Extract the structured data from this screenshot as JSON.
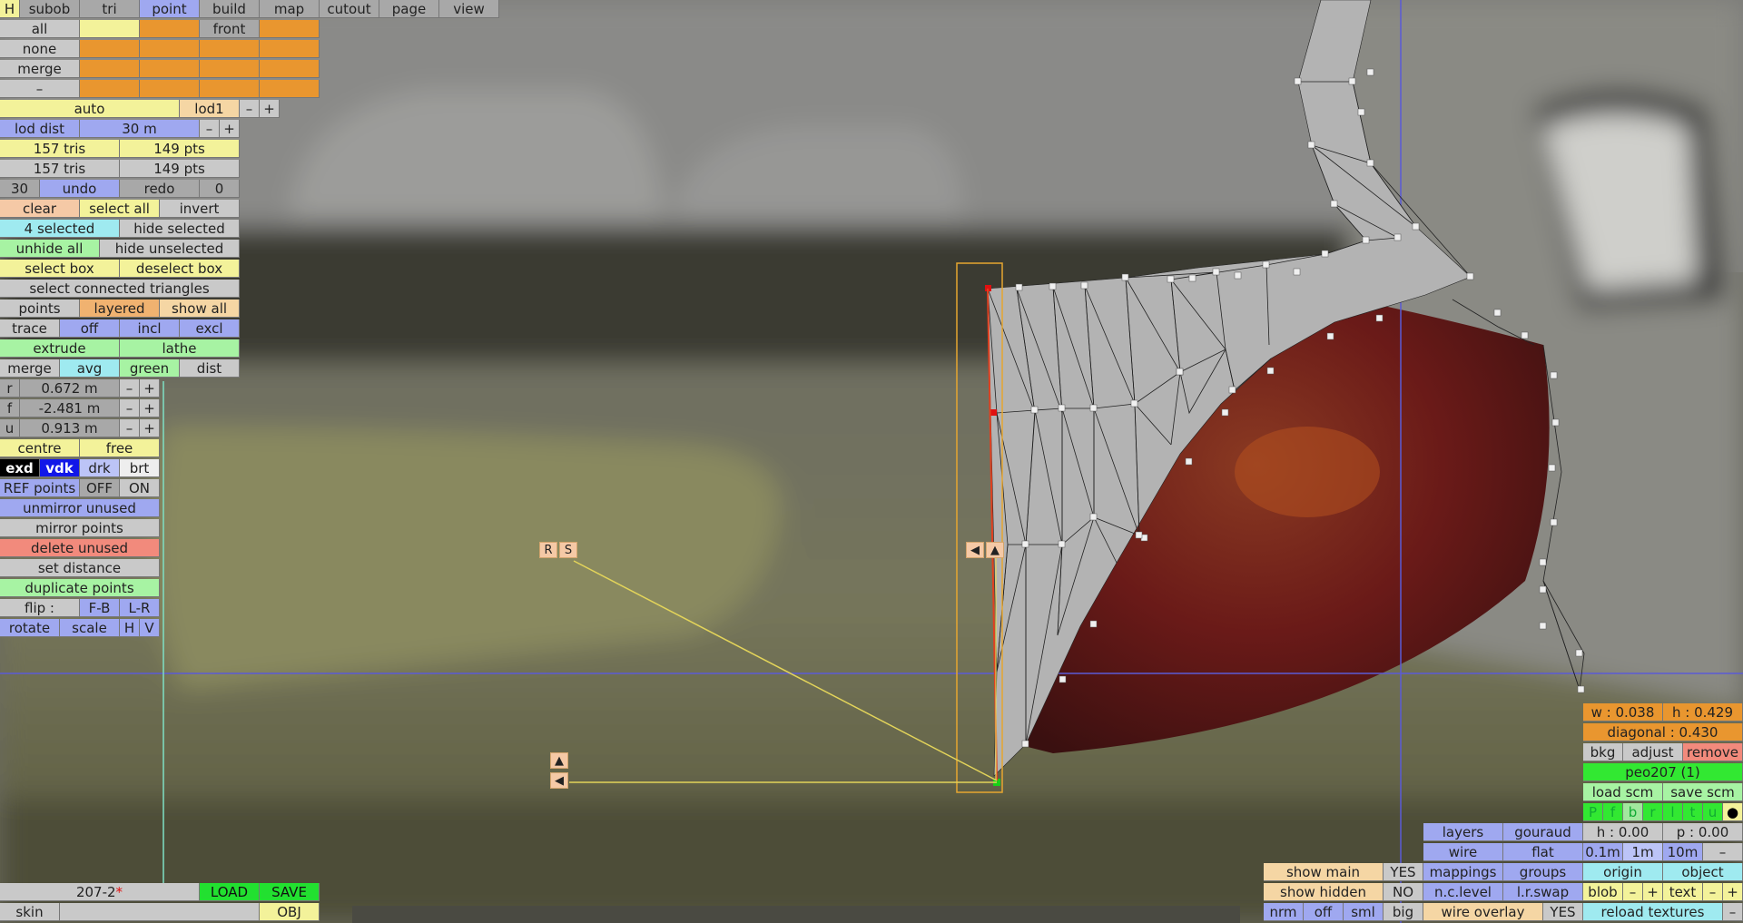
{
  "top_menu": {
    "h": "H",
    "items": [
      "subob",
      "tri",
      "point",
      "build",
      "map",
      "cutout",
      "page",
      "view"
    ],
    "active": "point"
  },
  "grid": {
    "all": "all",
    "front": "front",
    "none": "none",
    "merge": "merge",
    "dash": "–"
  },
  "lod": {
    "auto": "auto",
    "lod1": "lod1",
    "minus": "–",
    "plus": "+",
    "lod_dist_label": "lod dist",
    "lod_dist_value": "30 m"
  },
  "stats": {
    "tris1": "157 tris",
    "pts1": "149 pts",
    "tris2": "157 tris",
    "pts2": "149 pts"
  },
  "history": {
    "undo_count": "30",
    "undo": "undo",
    "redo": "redo",
    "redo_count": "0"
  },
  "selection": {
    "clear": "clear",
    "select_all": "select all",
    "invert": "invert",
    "selected": "4 selected",
    "hide_selected": "hide selected",
    "unhide_all": "unhide all",
    "hide_unselected": "hide unselected",
    "select_box": "select box",
    "deselect_box": "deselect box",
    "select_connected": "select connected triangles"
  },
  "points_row": {
    "points": "points",
    "layered": "layered",
    "show_all": "show all"
  },
  "trace_row": {
    "trace": "trace",
    "off": "off",
    "incl": "incl",
    "excl": "excl"
  },
  "ops": {
    "extrude": "extrude",
    "lathe": "lathe",
    "merge": "merge",
    "avg": "avg",
    "green": "green",
    "dist": "dist"
  },
  "coords": {
    "r_label": "r",
    "r_value": "0.672 m",
    "f_label": "f",
    "f_value": "-2.481 m",
    "u_label": "u",
    "u_value": "0.913 m"
  },
  "pivot": {
    "centre": "centre",
    "free": "free"
  },
  "shade": {
    "exd": "exd",
    "vdk": "vdk",
    "drk": "drk",
    "brt": "brt"
  },
  "ref_points": {
    "label": "REF points",
    "off": "OFF",
    "on": "ON"
  },
  "actions": {
    "unmirror": "unmirror unused",
    "mirror": "mirror points",
    "delete_unused": "delete unused",
    "set_distance": "set distance",
    "duplicate": "duplicate points"
  },
  "flip": {
    "label": "flip :",
    "fb": "F-B",
    "lr": "L-R"
  },
  "transform": {
    "rotate": "rotate",
    "scale": "scale",
    "h": "H",
    "v": "V"
  },
  "file": {
    "name": "207-2",
    "modified": "*",
    "load": "LOAD",
    "save": "SAVE",
    "skin": "skin",
    "obj": "OBJ"
  },
  "handles": {
    "r": "R",
    "s": "S",
    "left": "◀",
    "up": "▲"
  },
  "right_panel": {
    "w": "w : 0.038",
    "h": "h : 0.429",
    "diagonal": "diagonal : 0.430",
    "bkg": "bkg",
    "adjust": "adjust",
    "remove": "remove",
    "model": "peo207 (1)",
    "load_scm": "load scm",
    "save_scm": "save scm",
    "channels": [
      "P",
      "f",
      "b",
      "r",
      "l",
      "t",
      "u",
      "●"
    ]
  },
  "view_panel": {
    "layers": "layers",
    "gouraud": "gouraud",
    "h0": "h : 0.00",
    "p0": "p : 0.00",
    "wire": "wire",
    "flat": "flat",
    "s01": "0.1m",
    "s1": "1m",
    "s10": "10m",
    "dash": "–",
    "mappings": "mappings",
    "groups": "groups",
    "origin": "origin",
    "object": "object",
    "nclevel": "n.c.level",
    "lrswap": "l.r.swap",
    "blob": "blob",
    "text": "text",
    "minus": "–",
    "plus": "+",
    "wire_overlay": "wire overlay",
    "yes": "YES",
    "reload": "reload textures"
  },
  "show_panel": {
    "show_main": "show main",
    "yes": "YES",
    "show_hidden": "show hidden",
    "no": "NO",
    "nrm": "nrm",
    "off": "off",
    "sml": "sml",
    "big": "big"
  }
}
